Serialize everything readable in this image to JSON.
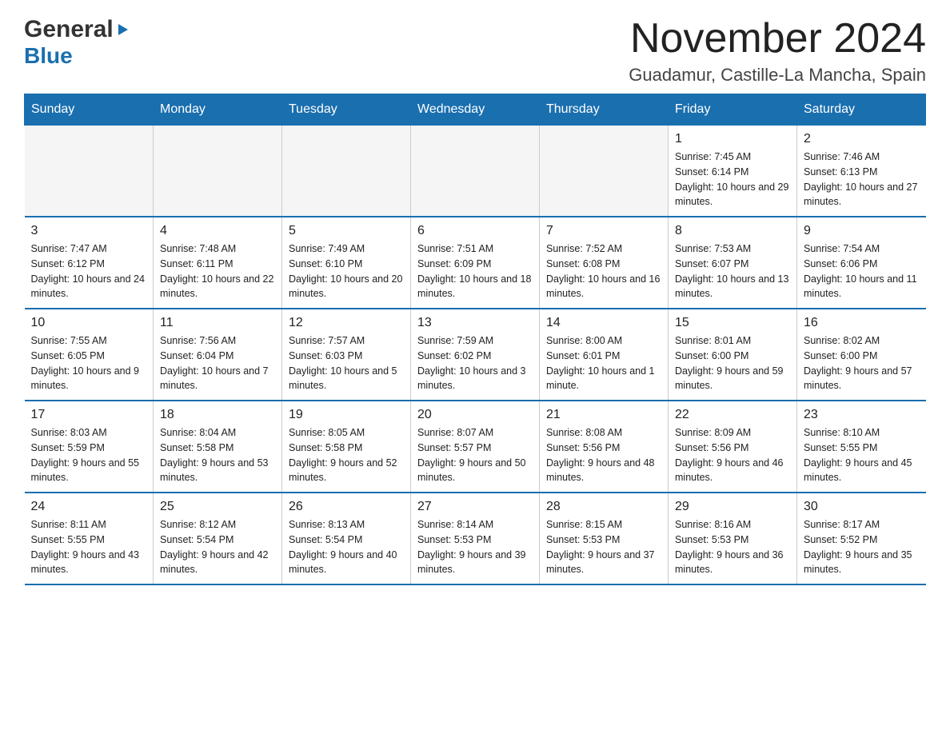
{
  "header": {
    "logo_general": "General",
    "logo_blue": "Blue",
    "month_title": "November 2024",
    "location": "Guadamur, Castille-La Mancha, Spain"
  },
  "days_of_week": [
    "Sunday",
    "Monday",
    "Tuesday",
    "Wednesday",
    "Thursday",
    "Friday",
    "Saturday"
  ],
  "weeks": [
    [
      {
        "day": "",
        "info": ""
      },
      {
        "day": "",
        "info": ""
      },
      {
        "day": "",
        "info": ""
      },
      {
        "day": "",
        "info": ""
      },
      {
        "day": "",
        "info": ""
      },
      {
        "day": "1",
        "info": "Sunrise: 7:45 AM\nSunset: 6:14 PM\nDaylight: 10 hours and 29 minutes."
      },
      {
        "day": "2",
        "info": "Sunrise: 7:46 AM\nSunset: 6:13 PM\nDaylight: 10 hours and 27 minutes."
      }
    ],
    [
      {
        "day": "3",
        "info": "Sunrise: 7:47 AM\nSunset: 6:12 PM\nDaylight: 10 hours and 24 minutes."
      },
      {
        "day": "4",
        "info": "Sunrise: 7:48 AM\nSunset: 6:11 PM\nDaylight: 10 hours and 22 minutes."
      },
      {
        "day": "5",
        "info": "Sunrise: 7:49 AM\nSunset: 6:10 PM\nDaylight: 10 hours and 20 minutes."
      },
      {
        "day": "6",
        "info": "Sunrise: 7:51 AM\nSunset: 6:09 PM\nDaylight: 10 hours and 18 minutes."
      },
      {
        "day": "7",
        "info": "Sunrise: 7:52 AM\nSunset: 6:08 PM\nDaylight: 10 hours and 16 minutes."
      },
      {
        "day": "8",
        "info": "Sunrise: 7:53 AM\nSunset: 6:07 PM\nDaylight: 10 hours and 13 minutes."
      },
      {
        "day": "9",
        "info": "Sunrise: 7:54 AM\nSunset: 6:06 PM\nDaylight: 10 hours and 11 minutes."
      }
    ],
    [
      {
        "day": "10",
        "info": "Sunrise: 7:55 AM\nSunset: 6:05 PM\nDaylight: 10 hours and 9 minutes."
      },
      {
        "day": "11",
        "info": "Sunrise: 7:56 AM\nSunset: 6:04 PM\nDaylight: 10 hours and 7 minutes."
      },
      {
        "day": "12",
        "info": "Sunrise: 7:57 AM\nSunset: 6:03 PM\nDaylight: 10 hours and 5 minutes."
      },
      {
        "day": "13",
        "info": "Sunrise: 7:59 AM\nSunset: 6:02 PM\nDaylight: 10 hours and 3 minutes."
      },
      {
        "day": "14",
        "info": "Sunrise: 8:00 AM\nSunset: 6:01 PM\nDaylight: 10 hours and 1 minute."
      },
      {
        "day": "15",
        "info": "Sunrise: 8:01 AM\nSunset: 6:00 PM\nDaylight: 9 hours and 59 minutes."
      },
      {
        "day": "16",
        "info": "Sunrise: 8:02 AM\nSunset: 6:00 PM\nDaylight: 9 hours and 57 minutes."
      }
    ],
    [
      {
        "day": "17",
        "info": "Sunrise: 8:03 AM\nSunset: 5:59 PM\nDaylight: 9 hours and 55 minutes."
      },
      {
        "day": "18",
        "info": "Sunrise: 8:04 AM\nSunset: 5:58 PM\nDaylight: 9 hours and 53 minutes."
      },
      {
        "day": "19",
        "info": "Sunrise: 8:05 AM\nSunset: 5:58 PM\nDaylight: 9 hours and 52 minutes."
      },
      {
        "day": "20",
        "info": "Sunrise: 8:07 AM\nSunset: 5:57 PM\nDaylight: 9 hours and 50 minutes."
      },
      {
        "day": "21",
        "info": "Sunrise: 8:08 AM\nSunset: 5:56 PM\nDaylight: 9 hours and 48 minutes."
      },
      {
        "day": "22",
        "info": "Sunrise: 8:09 AM\nSunset: 5:56 PM\nDaylight: 9 hours and 46 minutes."
      },
      {
        "day": "23",
        "info": "Sunrise: 8:10 AM\nSunset: 5:55 PM\nDaylight: 9 hours and 45 minutes."
      }
    ],
    [
      {
        "day": "24",
        "info": "Sunrise: 8:11 AM\nSunset: 5:55 PM\nDaylight: 9 hours and 43 minutes."
      },
      {
        "day": "25",
        "info": "Sunrise: 8:12 AM\nSunset: 5:54 PM\nDaylight: 9 hours and 42 minutes."
      },
      {
        "day": "26",
        "info": "Sunrise: 8:13 AM\nSunset: 5:54 PM\nDaylight: 9 hours and 40 minutes."
      },
      {
        "day": "27",
        "info": "Sunrise: 8:14 AM\nSunset: 5:53 PM\nDaylight: 9 hours and 39 minutes."
      },
      {
        "day": "28",
        "info": "Sunrise: 8:15 AM\nSunset: 5:53 PM\nDaylight: 9 hours and 37 minutes."
      },
      {
        "day": "29",
        "info": "Sunrise: 8:16 AM\nSunset: 5:53 PM\nDaylight: 9 hours and 36 minutes."
      },
      {
        "day": "30",
        "info": "Sunrise: 8:17 AM\nSunset: 5:52 PM\nDaylight: 9 hours and 35 minutes."
      }
    ]
  ]
}
